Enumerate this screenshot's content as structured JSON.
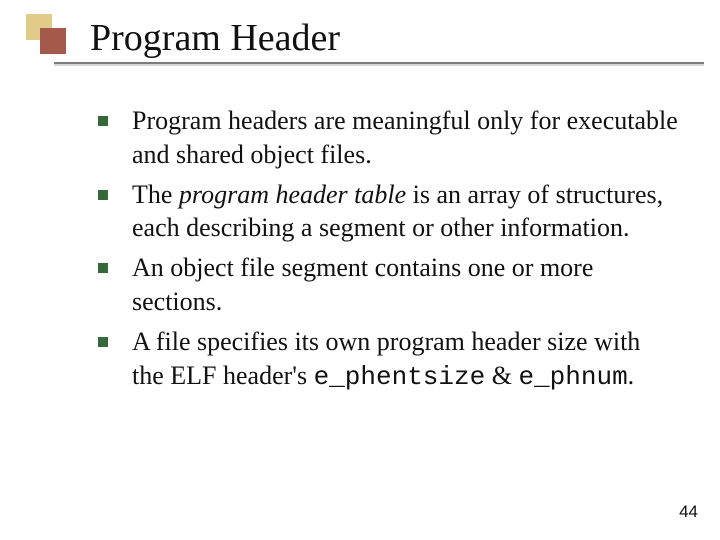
{
  "title": "Program Header",
  "bullets": {
    "b0": "Program headers are meaningful only for executable and shared object files.",
    "b1_pre": "The ",
    "b1_em": "program header table",
    "b1_post": " is an array of structures, each describing a segment or other information.",
    "b2": "An object file segment contains one or more sections.",
    "b3_pre": "A file specifies its own program header size with the ELF header's ",
    "b3_code1": "e_phentsize",
    "b3_mid": " & ",
    "b3_code2": "e_phnum",
    "b3_post": "."
  },
  "page_number": "44"
}
